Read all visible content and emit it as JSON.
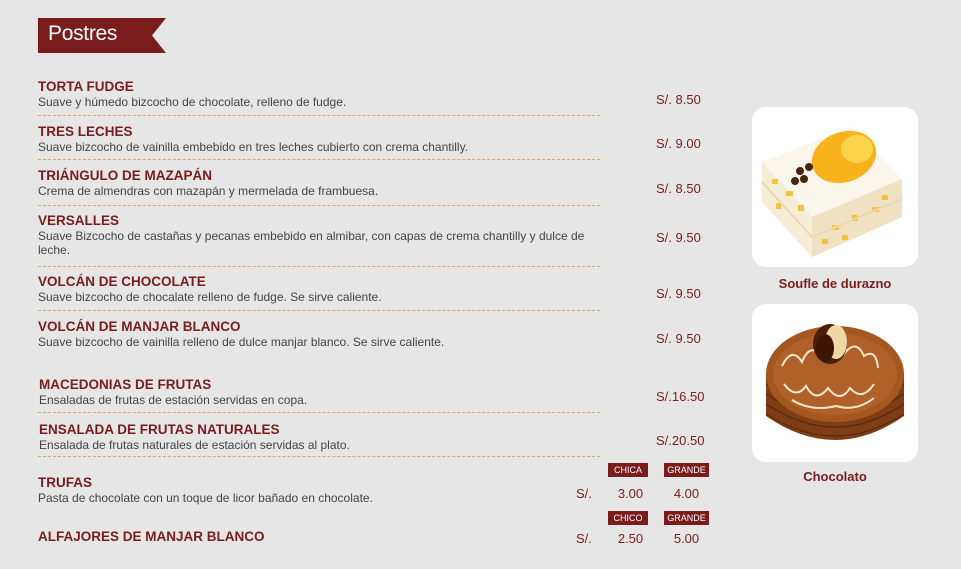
{
  "section_title": "Postres",
  "items": [
    {
      "name": "TORTA FUDGE",
      "desc": "Suave y húmedo bizcocho de chocolate, relleno de fudge.",
      "price": "S/.  8.50"
    },
    {
      "name": "TRES LECHES",
      "desc": "Suave bizcocho de vainilla embebido en tres leches cubierto con crema chantilly.",
      "price": "S/.  9.00"
    },
    {
      "name": "TRIÁNGULO DE MAZAPÁN",
      "desc": "Crema de almendras con mazapán y mermelada de frambuesa.",
      "price": "S/.  8.50"
    },
    {
      "name": "VERSALLES",
      "desc": "Suave Bizcocho de castañas y pecanas embebido en almibar, con capas de crema chantilly y dulce de leche.",
      "price": "S/.  9.50"
    },
    {
      "name": "VOLCÁN DE CHOCOLATE",
      "desc": "Suave bizcocho de chocalate relleno de fudge. Se sirve caliente.",
      "price": "S/.  9.50"
    },
    {
      "name": "VOLCÁN DE MANJAR BLANCO",
      "desc": "Suave bizcocho de vainilla relleno de dulce manjar blanco. Se sirve caliente.",
      "price": "S/.  9.50"
    },
    {
      "name": "MACEDONIAS DE FRUTAS",
      "desc": "Ensaladas de frutas de estación servidas en copa.",
      "price": "S/.16.50"
    },
    {
      "name": "ENSALADA DE FRUTAS NATURALES",
      "desc": "Ensalada de frutas naturales de estación servidas al plato.",
      "price": "S/.20.50"
    }
  ],
  "trufas": {
    "name": "TRUFAS",
    "desc": "Pasta de chocolate con un toque de licor bañado en chocolate.",
    "currency": "S/.",
    "size_small": "CHICA",
    "size_large": "GRANDE",
    "price_small": "3.00",
    "price_large": "4.00"
  },
  "alfajores": {
    "name": "ALFAJORES DE MANJAR BLANCO",
    "currency": "S/.",
    "size_small": "CHICO",
    "size_large": "GRANDE",
    "price_small": "2.50",
    "price_large": "5.00"
  },
  "photos": [
    {
      "caption": "Soufle de durazno"
    },
    {
      "caption": "Chocolato"
    }
  ],
  "colors": {
    "accent": "#7a1c1c",
    "divider": "#e0a75c",
    "background": "#e7e6e6"
  }
}
